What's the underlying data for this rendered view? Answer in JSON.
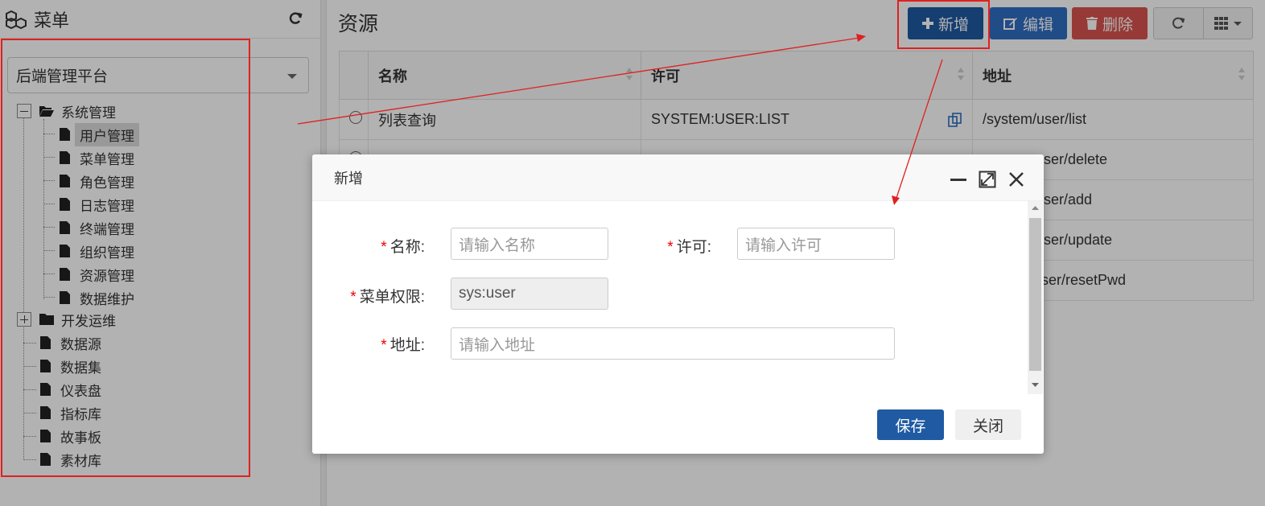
{
  "menu": {
    "title": "菜单",
    "platform_select": "后端管理平台",
    "tree": [
      {
        "label": "系统管理",
        "type": "folder-open"
      },
      {
        "label": "用户管理",
        "type": "doc",
        "selected": true
      },
      {
        "label": "菜单管理",
        "type": "doc"
      },
      {
        "label": "角色管理",
        "type": "doc"
      },
      {
        "label": "日志管理",
        "type": "doc"
      },
      {
        "label": "终端管理",
        "type": "doc"
      },
      {
        "label": "组织管理",
        "type": "doc"
      },
      {
        "label": "资源管理",
        "type": "doc"
      },
      {
        "label": "数据维护",
        "type": "doc"
      },
      {
        "label": "开发运维",
        "type": "folder"
      },
      {
        "label": "数据源",
        "type": "doc"
      },
      {
        "label": "数据集",
        "type": "doc"
      },
      {
        "label": "仪表盘",
        "type": "doc"
      },
      {
        "label": "指标库",
        "type": "doc"
      },
      {
        "label": "故事板",
        "type": "doc"
      },
      {
        "label": "素材库",
        "type": "doc"
      }
    ]
  },
  "resource": {
    "title": "资源",
    "toolbar": {
      "add": "新增",
      "edit": "编辑",
      "delete": "删除"
    },
    "columns": [
      "名称",
      "许可",
      "地址"
    ],
    "rows": [
      {
        "name": "列表查询",
        "perm": "SYSTEM:USER:LIST",
        "url": "/system/user/list"
      },
      {
        "name": "",
        "perm": "",
        "url": "user/delete"
      },
      {
        "name": "",
        "perm": "",
        "url": "user/add"
      },
      {
        "name": "",
        "perm": "",
        "url": "user/update"
      },
      {
        "name": "",
        "perm": "",
        "url": "ser/resetPwd"
      }
    ]
  },
  "dialog": {
    "title": "新增",
    "labels": {
      "name": "名称",
      "perm": "许可",
      "menu_perm": "菜单权限",
      "url": "地址"
    },
    "required_mark": "*",
    "colon": ":",
    "placeholders": {
      "name": "请输入名称",
      "perm": "请输入许可",
      "url": "请输入地址"
    },
    "menu_perm_value": "sys:user",
    "save": "保存",
    "close": "关闭"
  },
  "colors": {
    "primary": "#1f5aa3",
    "danger": "#d9534f",
    "annotation": "#e02020"
  }
}
